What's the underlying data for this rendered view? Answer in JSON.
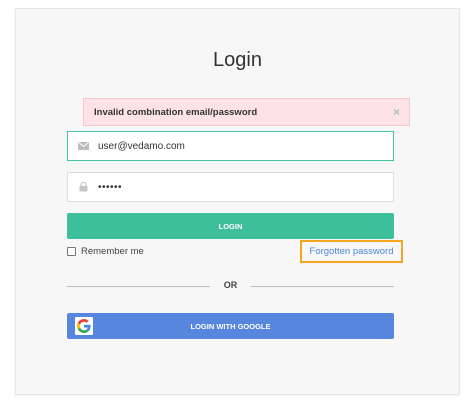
{
  "page": {
    "title": "Login"
  },
  "alert": {
    "message": "Invalid combination email/password",
    "close_symbol": "×"
  },
  "email": {
    "icon": "envelope-icon",
    "value": "user@vedamo.com"
  },
  "password": {
    "icon": "lock-icon",
    "masked_value": "••••••"
  },
  "login_button": {
    "label": "LOGIN"
  },
  "remember": {
    "label": "Remember me",
    "checked": false
  },
  "forgot": {
    "label": "Forgotten password"
  },
  "divider": {
    "label": "OR"
  },
  "google_button": {
    "label": "LOGIN WITH GOOGLE",
    "icon": "google-icon"
  },
  "colors": {
    "accent_green": "#3dbf9c",
    "google_blue": "#5686dd",
    "alert_bg": "#fde3e5",
    "highlight_orange": "#f5a623",
    "link_blue": "#4a88d8"
  }
}
